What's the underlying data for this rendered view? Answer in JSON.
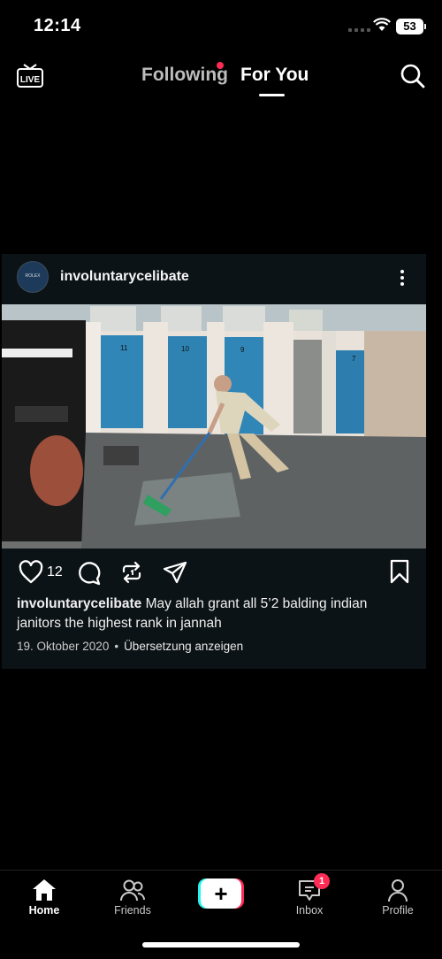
{
  "status": {
    "time": "12:14",
    "battery": "53"
  },
  "top_nav": {
    "live_label": "LIVE",
    "tabs": [
      {
        "label": "Following",
        "has_notification_dot": true
      },
      {
        "label": "For You",
        "active": true
      }
    ]
  },
  "post": {
    "username": "involuntarycelibate",
    "avatar_text": "ROLEX",
    "likes": "12",
    "caption_user": "involuntarycelibate",
    "caption_text": " May allah grant all 5’2 balding indian janitors the highest rank in jannah",
    "date": "19. Oktober 2020",
    "separator": "•",
    "translate_label": "Übersetzung anzeigen",
    "image": {
      "description_icon": "photo-restroom-janitor",
      "door_numbers": [
        "11",
        "10",
        "9",
        "7"
      ]
    }
  },
  "bottom_nav": {
    "items": [
      {
        "label": "Home",
        "icon": "home-icon",
        "active": true
      },
      {
        "label": "Friends",
        "icon": "friends-icon"
      },
      {
        "label": "",
        "icon": "create-icon"
      },
      {
        "label": "Inbox",
        "icon": "inbox-icon",
        "badge": "1"
      },
      {
        "label": "Profile",
        "icon": "profile-icon"
      }
    ]
  },
  "colors": {
    "accent": "#fe2c55",
    "cyan": "#25f4ee",
    "card_bg": "#0c1317"
  }
}
